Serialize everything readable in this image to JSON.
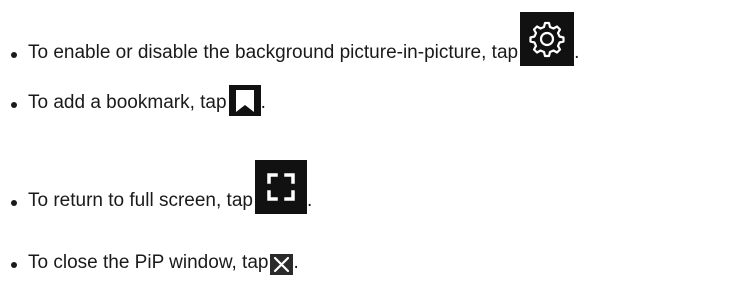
{
  "items": [
    {
      "text": "To enable or disable the background picture-in-picture, tap",
      "icon": "gear-icon",
      "suffix": "."
    },
    {
      "text": "To add a bookmark, tap",
      "icon": "bookmark-icon",
      "suffix": "."
    },
    {
      "text": "To return to full screen, tap",
      "icon": "fullscreen-icon",
      "suffix": "."
    },
    {
      "text": "To close the PiP window, tap",
      "icon": "close-icon",
      "suffix": "."
    }
  ],
  "colors": {
    "text": "#1a1a1a",
    "icon_bg": "#111111",
    "icon_fg": "#ffffff",
    "close_icon_bg": "#2a2a2a"
  }
}
